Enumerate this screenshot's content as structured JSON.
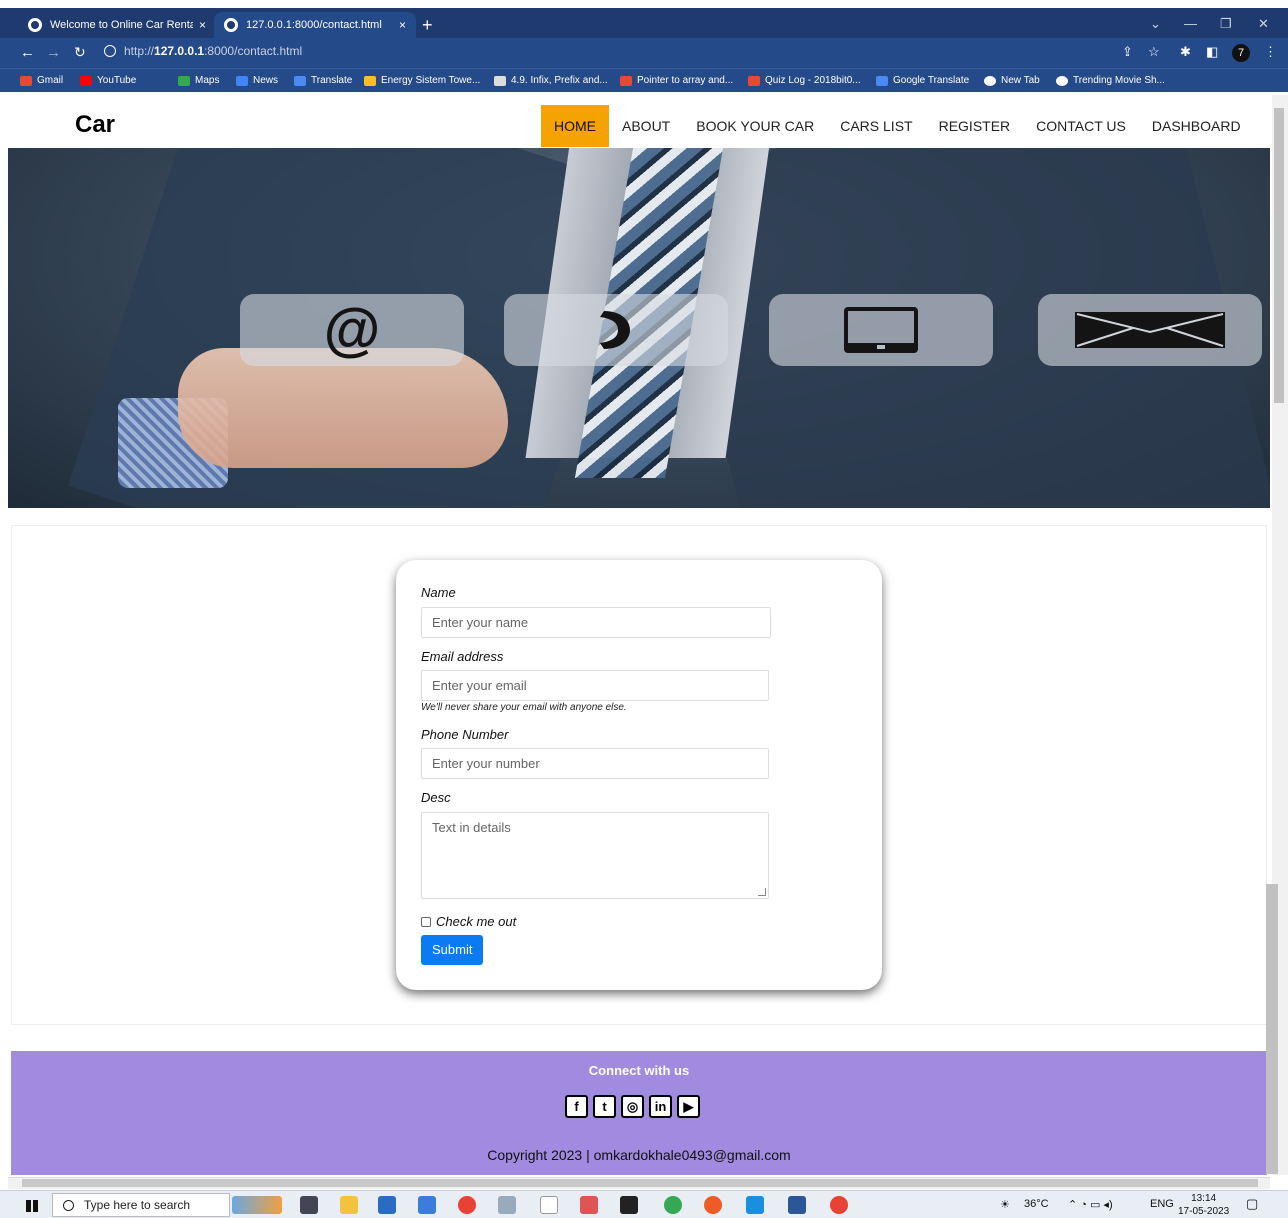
{
  "browser": {
    "tabs": [
      {
        "title": "Welcome to Online Car Rental sy",
        "close": "×"
      },
      {
        "title": "127.0.0.1:8000/contact.html",
        "close": "×"
      }
    ],
    "new_tab": "+",
    "url_prefix": "http://",
    "url_host": "127.0.0.1",
    "url_path": ":8000/contact.html",
    "profile": "7",
    "bookmarks": [
      "Gmail",
      "YouTube",
      "Maps",
      "News",
      "Translate",
      "Energy Sistem Towe...",
      "4.9. Infix, Prefix and...",
      "Pointer to array and...",
      "Quiz Log - 2018bit0...",
      "Google Translate",
      "New Tab",
      "Trending Movie Sh..."
    ]
  },
  "site": {
    "brand": "Car",
    "nav": [
      "HOME",
      "ABOUT",
      "BOOK YOUR CAR",
      "CARS LIST",
      "REGISTER",
      "CONTACT US",
      "DASHBOARD"
    ],
    "active_nav": "HOME",
    "colors": {
      "active": "#f5a300",
      "footer": "#a08be0",
      "submit": "#0b7bf3"
    }
  },
  "hero": {
    "icons": [
      "at-sign",
      "phone",
      "tablet",
      "envelope"
    ],
    "at_glyph": "@",
    "phone_glyph": "⌕"
  },
  "form": {
    "name_label": "Name",
    "name_placeholder": "Enter your name",
    "email_label": "Email address",
    "email_placeholder": "Enter your email",
    "email_help": "We'll never share your email with anyone else.",
    "phone_label": "Phone Number",
    "phone_placeholder": "Enter your number",
    "desc_label": "Desc",
    "desc_placeholder": "Text in details",
    "check_label": "Check me out",
    "submit": "Submit"
  },
  "footer": {
    "connect": "Connect with us",
    "social": [
      "facebook",
      "twitter",
      "instagram",
      "linkedin",
      "youtube"
    ],
    "social_glyphs": [
      "f",
      "t",
      "◎",
      "in",
      "▶"
    ],
    "copyright": "Copyright 2023 | omkardokhale0493@gmail.com"
  },
  "taskbar": {
    "search_placeholder": "Type here to search",
    "temp": "36°C",
    "lang": "ENG",
    "time": "13:14",
    "date": "17-05-2023"
  }
}
